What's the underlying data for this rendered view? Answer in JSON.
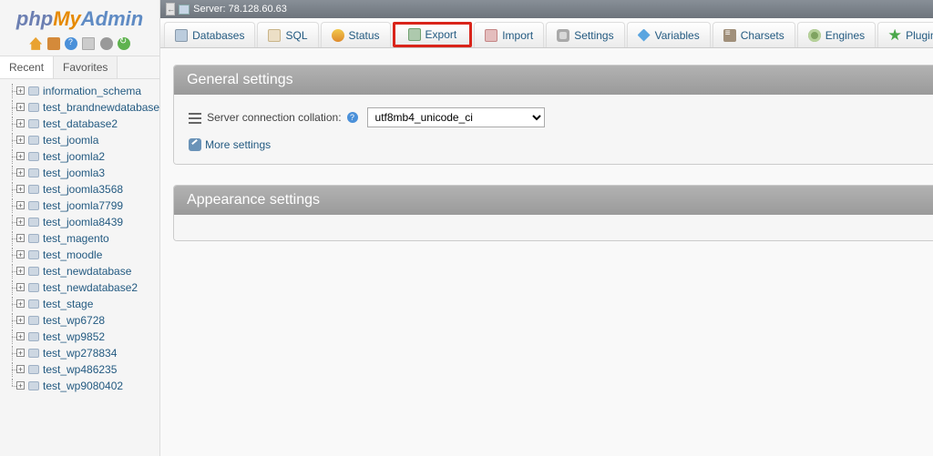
{
  "logo": {
    "part1": "php",
    "part2": "My",
    "part3": "Admin"
  },
  "sidebar_tabs": {
    "recent": "Recent",
    "favorites": "Favorites"
  },
  "databases": [
    "information_schema",
    "test_brandnewdatabase",
    "test_database2",
    "test_joomla",
    "test_joomla2",
    "test_joomla3",
    "test_joomla3568",
    "test_joomla7799",
    "test_joomla8439",
    "test_magento",
    "test_moodle",
    "test_newdatabase",
    "test_newdatabase2",
    "test_stage",
    "test_wp6728",
    "test_wp9852",
    "test_wp278834",
    "test_wp486235",
    "test_wp9080402"
  ],
  "server": {
    "prefix": "Server:",
    "host": "78.128.60.63"
  },
  "tabs": [
    {
      "label": "Databases",
      "icon": "ti-db"
    },
    {
      "label": "SQL",
      "icon": "ti-sql"
    },
    {
      "label": "Status",
      "icon": "ti-status"
    },
    {
      "label": "Export",
      "icon": "ti-export",
      "highlight": true
    },
    {
      "label": "Import",
      "icon": "ti-import"
    },
    {
      "label": "Settings",
      "icon": "ti-settings"
    },
    {
      "label": "Variables",
      "icon": "ti-var"
    },
    {
      "label": "Charsets",
      "icon": "ti-char"
    },
    {
      "label": "Engines",
      "icon": "ti-eng"
    },
    {
      "label": "Plugins",
      "icon": "ti-plug"
    }
  ],
  "panels": {
    "general": {
      "title": "General settings",
      "collation_label": "Server connection collation:",
      "collation_value": "utf8mb4_unicode_ci",
      "more": "More settings"
    },
    "appearance": {
      "title": "Appearance settings"
    }
  },
  "collapse_glyph": "←",
  "help_glyph": "?"
}
